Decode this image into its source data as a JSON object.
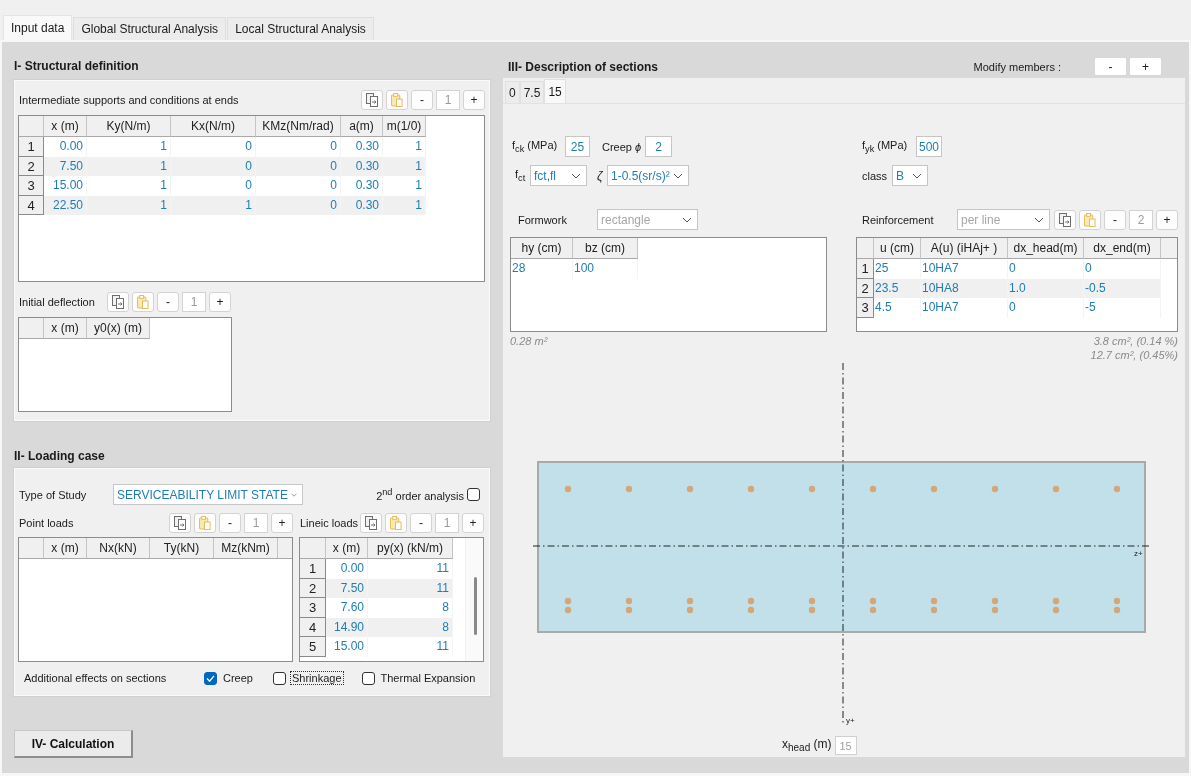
{
  "tabs": [
    {
      "label": "Input data",
      "selected": true
    },
    {
      "label": "Global Structural Analysis",
      "selected": false
    },
    {
      "label": "Local Structural Analysis",
      "selected": false
    }
  ],
  "structural_definition": {
    "title": "I- Structural definition",
    "supports": {
      "label": "Intermediate supports and conditions at ends",
      "stepper": {
        "decrement": "-",
        "value": "1",
        "increment": "+"
      },
      "columns": [
        "x (m)",
        "Ky(N/m)",
        "Kx(N/m)",
        "KMz(Nm/rad)",
        "a(m)",
        "m(1/0)"
      ],
      "rows": [
        {
          "header": "1",
          "cells": [
            "0.00",
            "1",
            "0",
            "0",
            "0.30",
            "1"
          ]
        },
        {
          "header": "2",
          "cells": [
            "7.50",
            "1",
            "0",
            "0",
            "0.30",
            "1"
          ]
        },
        {
          "header": "3",
          "cells": [
            "15.00",
            "1",
            "0",
            "0",
            "0.30",
            "1"
          ]
        },
        {
          "header": "4",
          "cells": [
            "22.50",
            "1",
            "1",
            "0",
            "0.30",
            "1"
          ]
        }
      ]
    },
    "initial_deflection": {
      "label": "Initial deflection",
      "stepper": {
        "decrement": "-",
        "value": "1",
        "increment": "+"
      },
      "columns": [
        "x (m)",
        "y0(x) (m)"
      ]
    }
  },
  "loading_case": {
    "title": "II- Loading case",
    "type_of_study": {
      "label": "Type of Study",
      "value": "SERVICEABILITY LIMIT STATE",
      "disabled": false
    },
    "second_order_analysis": {
      "label": "2$^{nd}$ order analysis",
      "checked": false
    },
    "point_loads": {
      "label": "Point loads",
      "stepper": {
        "decrement": "-",
        "value": "1",
        "increment": "+"
      },
      "columns": [
        "x (m)",
        "Nx(kN)",
        "Ty(kN)",
        "Mz(kNm)"
      ]
    },
    "lineic_loads": {
      "label": "Lineic loads",
      "stepper": {
        "decrement": "-",
        "value": "1",
        "increment": "+"
      },
      "columns": [
        "x (m)",
        "py(x) (kN/m)"
      ],
      "rows": [
        {
          "header": "1",
          "cells": [
            "0.00",
            "11"
          ]
        },
        {
          "header": "2",
          "cells": [
            "7.50",
            "11"
          ]
        },
        {
          "header": "3",
          "cells": [
            "7.60",
            "8"
          ]
        },
        {
          "header": "4",
          "cells": [
            "14.90",
            "8"
          ]
        },
        {
          "header": "5",
          "cells": [
            "15.00",
            "11"
          ]
        }
      ]
    },
    "additional_effects": {
      "label": "Additional effects on sections",
      "options": [
        {
          "label": "Creep",
          "checked": true,
          "focused": false
        },
        {
          "label": "Shrinkage",
          "checked": false,
          "focused": true
        },
        {
          "label": "Thermal Expansion",
          "checked": false,
          "focused": false
        }
      ]
    }
  },
  "calculation_button": {
    "label": "IV- Calculation"
  },
  "sections": {
    "title": "III- Description of sections",
    "modify_members": {
      "label": "Modify members :",
      "decrement": "-",
      "increment": "+"
    },
    "tabs": [
      {
        "label": "0",
        "selected": false
      },
      {
        "label": "7.5",
        "selected": false
      },
      {
        "label": "15",
        "selected": true
      }
    ],
    "concrete": {
      "fck": {
        "label": "f$_{ck}$ (MPa)",
        "value": "25"
      },
      "creep": {
        "label": "Creep *ϕ*",
        "value": "2"
      },
      "fct": {
        "label": "f$_{ct}$",
        "value": "fct,fl",
        "disabled": false
      },
      "zeta": {
        "label": "ζ",
        "value": "1-0.5(sr/s)²",
        "disabled": false
      }
    },
    "steel": {
      "fyk": {
        "label": "f$_{yk}$ (MPa)",
        "value": "500"
      },
      "steel_class": {
        "label": "class",
        "value": "B",
        "disabled": false
      }
    },
    "formwork": {
      "label": "Formwork",
      "shape": {
        "value": "rectangle",
        "disabled": true
      },
      "columns": [
        "hy (cm)",
        "bz (cm)"
      ],
      "rows": [
        {
          "cells": [
            "28",
            "100"
          ]
        }
      ],
      "area": "0.28 m²"
    },
    "reinforcement": {
      "label": "Reinforcement",
      "layout": {
        "value": "per line",
        "disabled": true
      },
      "stepper": {
        "decrement": "-",
        "value": "2",
        "increment": "+"
      },
      "columns": [
        "u (cm)",
        "A(u) (iHAj+ )",
        "dx_head(m)",
        "dx_end(m)"
      ],
      "rows": [
        {
          "header": "1",
          "cells": [
            "25",
            "10HA7",
            "0",
            "0"
          ]
        },
        {
          "header": "2",
          "cells": [
            "23.5",
            "10HA8",
            "1.0",
            "-0.5"
          ]
        },
        {
          "header": "3",
          "cells": [
            "4.5",
            "10HA7",
            "0",
            "-5"
          ]
        }
      ],
      "totals": [
        "3.8 cm², (0.14 %)",
        "12.7 cm², (0.45%)"
      ]
    },
    "section_drawing": {
      "z_axis": "z+",
      "y_axis": "y+"
    },
    "x_head": {
      "label": "x$_{head}$ (m)",
      "value": "15"
    }
  }
}
